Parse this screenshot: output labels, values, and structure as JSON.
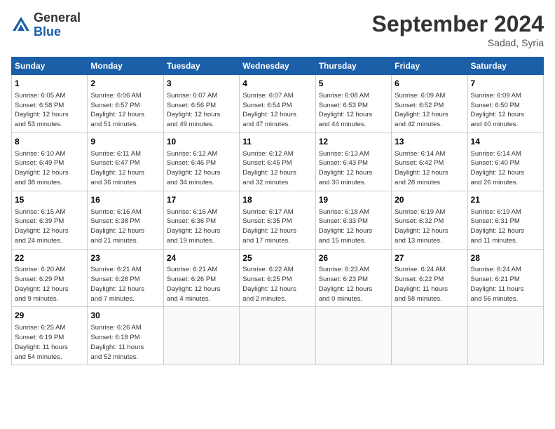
{
  "header": {
    "logo_general": "General",
    "logo_blue": "Blue",
    "month_title": "September 2024",
    "location": "Sadad, Syria"
  },
  "weekdays": [
    "Sunday",
    "Monday",
    "Tuesday",
    "Wednesday",
    "Thursday",
    "Friday",
    "Saturday"
  ],
  "weeks": [
    [
      {
        "day": "1",
        "info": "Sunrise: 6:05 AM\nSunset: 6:58 PM\nDaylight: 12 hours\nand 53 minutes."
      },
      {
        "day": "2",
        "info": "Sunrise: 6:06 AM\nSunset: 6:57 PM\nDaylight: 12 hours\nand 51 minutes."
      },
      {
        "day": "3",
        "info": "Sunrise: 6:07 AM\nSunset: 6:56 PM\nDaylight: 12 hours\nand 49 minutes."
      },
      {
        "day": "4",
        "info": "Sunrise: 6:07 AM\nSunset: 6:54 PM\nDaylight: 12 hours\nand 47 minutes."
      },
      {
        "day": "5",
        "info": "Sunrise: 6:08 AM\nSunset: 6:53 PM\nDaylight: 12 hours\nand 44 minutes."
      },
      {
        "day": "6",
        "info": "Sunrise: 6:09 AM\nSunset: 6:52 PM\nDaylight: 12 hours\nand 42 minutes."
      },
      {
        "day": "7",
        "info": "Sunrise: 6:09 AM\nSunset: 6:50 PM\nDaylight: 12 hours\nand 40 minutes."
      }
    ],
    [
      {
        "day": "8",
        "info": "Sunrise: 6:10 AM\nSunset: 6:49 PM\nDaylight: 12 hours\nand 38 minutes."
      },
      {
        "day": "9",
        "info": "Sunrise: 6:11 AM\nSunset: 6:47 PM\nDaylight: 12 hours\nand 36 minutes."
      },
      {
        "day": "10",
        "info": "Sunrise: 6:12 AM\nSunset: 6:46 PM\nDaylight: 12 hours\nand 34 minutes."
      },
      {
        "day": "11",
        "info": "Sunrise: 6:12 AM\nSunset: 6:45 PM\nDaylight: 12 hours\nand 32 minutes."
      },
      {
        "day": "12",
        "info": "Sunrise: 6:13 AM\nSunset: 6:43 PM\nDaylight: 12 hours\nand 30 minutes."
      },
      {
        "day": "13",
        "info": "Sunrise: 6:14 AM\nSunset: 6:42 PM\nDaylight: 12 hours\nand 28 minutes."
      },
      {
        "day": "14",
        "info": "Sunrise: 6:14 AM\nSunset: 6:40 PM\nDaylight: 12 hours\nand 26 minutes."
      }
    ],
    [
      {
        "day": "15",
        "info": "Sunrise: 6:15 AM\nSunset: 6:39 PM\nDaylight: 12 hours\nand 24 minutes."
      },
      {
        "day": "16",
        "info": "Sunrise: 6:16 AM\nSunset: 6:38 PM\nDaylight: 12 hours\nand 21 minutes."
      },
      {
        "day": "17",
        "info": "Sunrise: 6:16 AM\nSunset: 6:36 PM\nDaylight: 12 hours\nand 19 minutes."
      },
      {
        "day": "18",
        "info": "Sunrise: 6:17 AM\nSunset: 6:35 PM\nDaylight: 12 hours\nand 17 minutes."
      },
      {
        "day": "19",
        "info": "Sunrise: 6:18 AM\nSunset: 6:33 PM\nDaylight: 12 hours\nand 15 minutes."
      },
      {
        "day": "20",
        "info": "Sunrise: 6:19 AM\nSunset: 6:32 PM\nDaylight: 12 hours\nand 13 minutes."
      },
      {
        "day": "21",
        "info": "Sunrise: 6:19 AM\nSunset: 6:31 PM\nDaylight: 12 hours\nand 11 minutes."
      }
    ],
    [
      {
        "day": "22",
        "info": "Sunrise: 6:20 AM\nSunset: 6:29 PM\nDaylight: 12 hours\nand 9 minutes."
      },
      {
        "day": "23",
        "info": "Sunrise: 6:21 AM\nSunset: 6:28 PM\nDaylight: 12 hours\nand 7 minutes."
      },
      {
        "day": "24",
        "info": "Sunrise: 6:21 AM\nSunset: 6:26 PM\nDaylight: 12 hours\nand 4 minutes."
      },
      {
        "day": "25",
        "info": "Sunrise: 6:22 AM\nSunset: 6:25 PM\nDaylight: 12 hours\nand 2 minutes."
      },
      {
        "day": "26",
        "info": "Sunrise: 6:23 AM\nSunset: 6:23 PM\nDaylight: 12 hours\nand 0 minutes."
      },
      {
        "day": "27",
        "info": "Sunrise: 6:24 AM\nSunset: 6:22 PM\nDaylight: 11 hours\nand 58 minutes."
      },
      {
        "day": "28",
        "info": "Sunrise: 6:24 AM\nSunset: 6:21 PM\nDaylight: 11 hours\nand 56 minutes."
      }
    ],
    [
      {
        "day": "29",
        "info": "Sunrise: 6:25 AM\nSunset: 6:19 PM\nDaylight: 11 hours\nand 54 minutes."
      },
      {
        "day": "30",
        "info": "Sunrise: 6:26 AM\nSunset: 6:18 PM\nDaylight: 11 hours\nand 52 minutes."
      },
      {
        "day": "",
        "info": ""
      },
      {
        "day": "",
        "info": ""
      },
      {
        "day": "",
        "info": ""
      },
      {
        "day": "",
        "info": ""
      },
      {
        "day": "",
        "info": ""
      }
    ]
  ]
}
